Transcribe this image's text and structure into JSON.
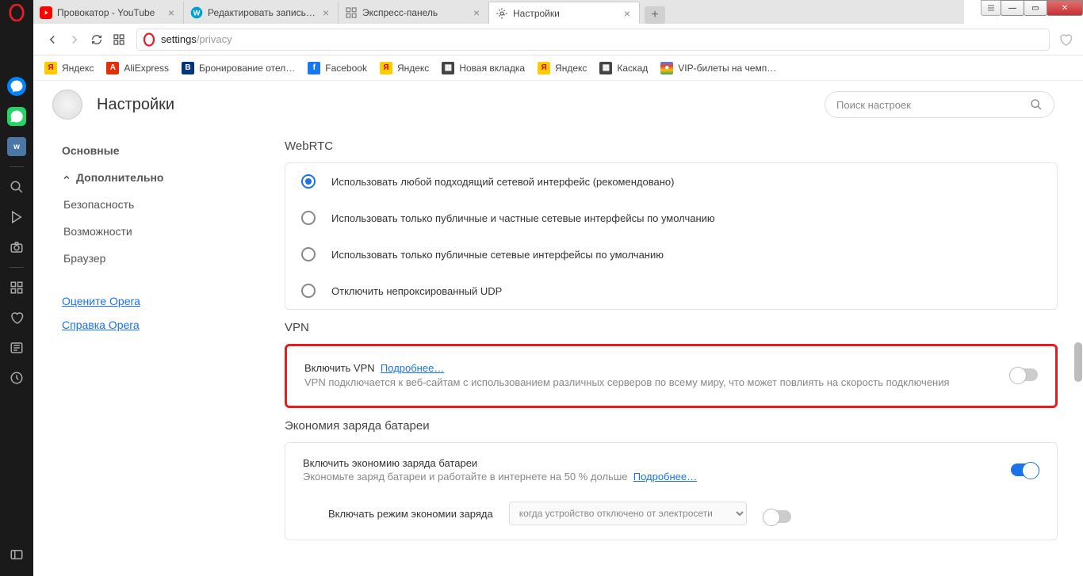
{
  "tabs": [
    {
      "title": "Провокатор - YouTube",
      "icon_color": "#ff0000"
    },
    {
      "title": "Редактировать запись ‹ Г…",
      "icon_color": "#00a0d2"
    },
    {
      "title": "Экспресс-панель",
      "icon_color": "#888"
    },
    {
      "title": "Настройки",
      "icon_color": "#888",
      "active": true
    }
  ],
  "address": {
    "prefix": "settings",
    "suffix": "/privacy"
  },
  "bookmarks": [
    {
      "label": "Яндекс",
      "color": "#ffcc00",
      "letter": "Я"
    },
    {
      "label": "AliExpress",
      "color": "#e62e04",
      "letter": "A"
    },
    {
      "label": "Бронирование отел…",
      "color": "#003580",
      "letter": "B"
    },
    {
      "label": "Facebook",
      "color": "#1877f2",
      "letter": "f"
    },
    {
      "label": "Яндекс",
      "color": "#ffcc00",
      "letter": "Я"
    },
    {
      "label": "Новая вкладка",
      "color": "#444",
      "letter": ""
    },
    {
      "label": "Яндекс",
      "color": "#ffcc00",
      "letter": "Я"
    },
    {
      "label": "Каскад",
      "color": "#444",
      "letter": ""
    },
    {
      "label": "VIP-билеты на чемп…",
      "color": "#ff9900",
      "letter": ""
    }
  ],
  "settings_header": {
    "title": "Настройки",
    "search_placeholder": "Поиск настроек"
  },
  "left_nav": {
    "basic": "Основные",
    "advanced": "Дополнительно",
    "security": "Безопасность",
    "features": "Возможности",
    "browser": "Браузер",
    "rate": "Оцените Opera",
    "help": "Справка Opera"
  },
  "webrtc": {
    "title": "WebRTC",
    "opt1": "Использовать любой подходящий сетевой интерфейс (рекомендовано)",
    "opt2": "Использовать только публичные и частные сетевые интерфейсы по умолчанию",
    "opt3": "Использовать только публичные сетевые интерфейсы по умолчанию",
    "opt4": "Отключить непроксированный UDP"
  },
  "vpn": {
    "title": "VPN",
    "enable": "Включить VPN",
    "more": "Подробнее…",
    "desc": "VPN подключается к веб-сайтам с использованием различных серверов по всему миру, что может повлиять на скорость подключения"
  },
  "battery": {
    "title": "Экономия заряда батареи",
    "enable": "Включить экономию заряда батареи",
    "desc_prefix": "Экономьте заряд батареи и работайте в интернете на 50 % дольше",
    "more": "Подробнее…",
    "mode_label": "Включать режим экономии заряда",
    "mode_value": "когда устройство отключено от электросети"
  }
}
